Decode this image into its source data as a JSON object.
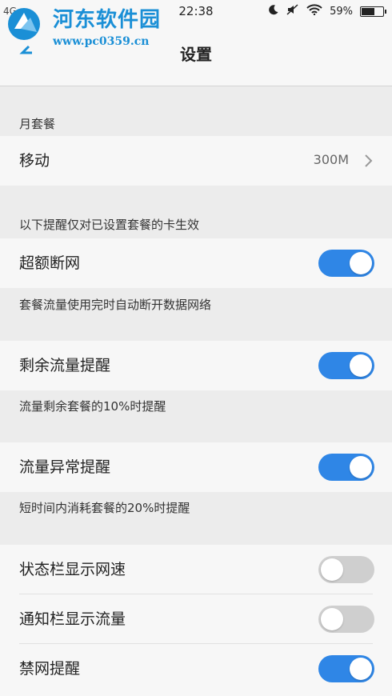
{
  "status_bar": {
    "network": "4G",
    "time": "22:38",
    "battery": "59%"
  },
  "watermark": {
    "brand": "河东软件园",
    "url": "www.pc0359.cn"
  },
  "header": {
    "title": "设置"
  },
  "plan_section": {
    "label": "月套餐",
    "carrier_label": "移动",
    "carrier_value": "300M"
  },
  "reminder_section": {
    "label": "以下提醒仅对已设置套餐的卡生效"
  },
  "settings": [
    {
      "label": "超额断网",
      "desc": "套餐流量使用完时自动断开数据网络",
      "on": true
    },
    {
      "label": "剩余流量提醒",
      "desc": "流量剩余套餐的10%时提醒",
      "on": true
    },
    {
      "label": "流量异常提醒",
      "desc": "短时间内消耗套餐的20%时提醒",
      "on": true
    },
    {
      "label": "状态栏显示网速",
      "on": false
    },
    {
      "label": "通知栏显示流量",
      "on": false
    },
    {
      "label": "禁网提醒",
      "on": true
    }
  ],
  "colors": {
    "accent": "#2f86e6",
    "toggle_off": "#cfcfcf",
    "background": "#ececec",
    "row": "#f7f7f7"
  }
}
